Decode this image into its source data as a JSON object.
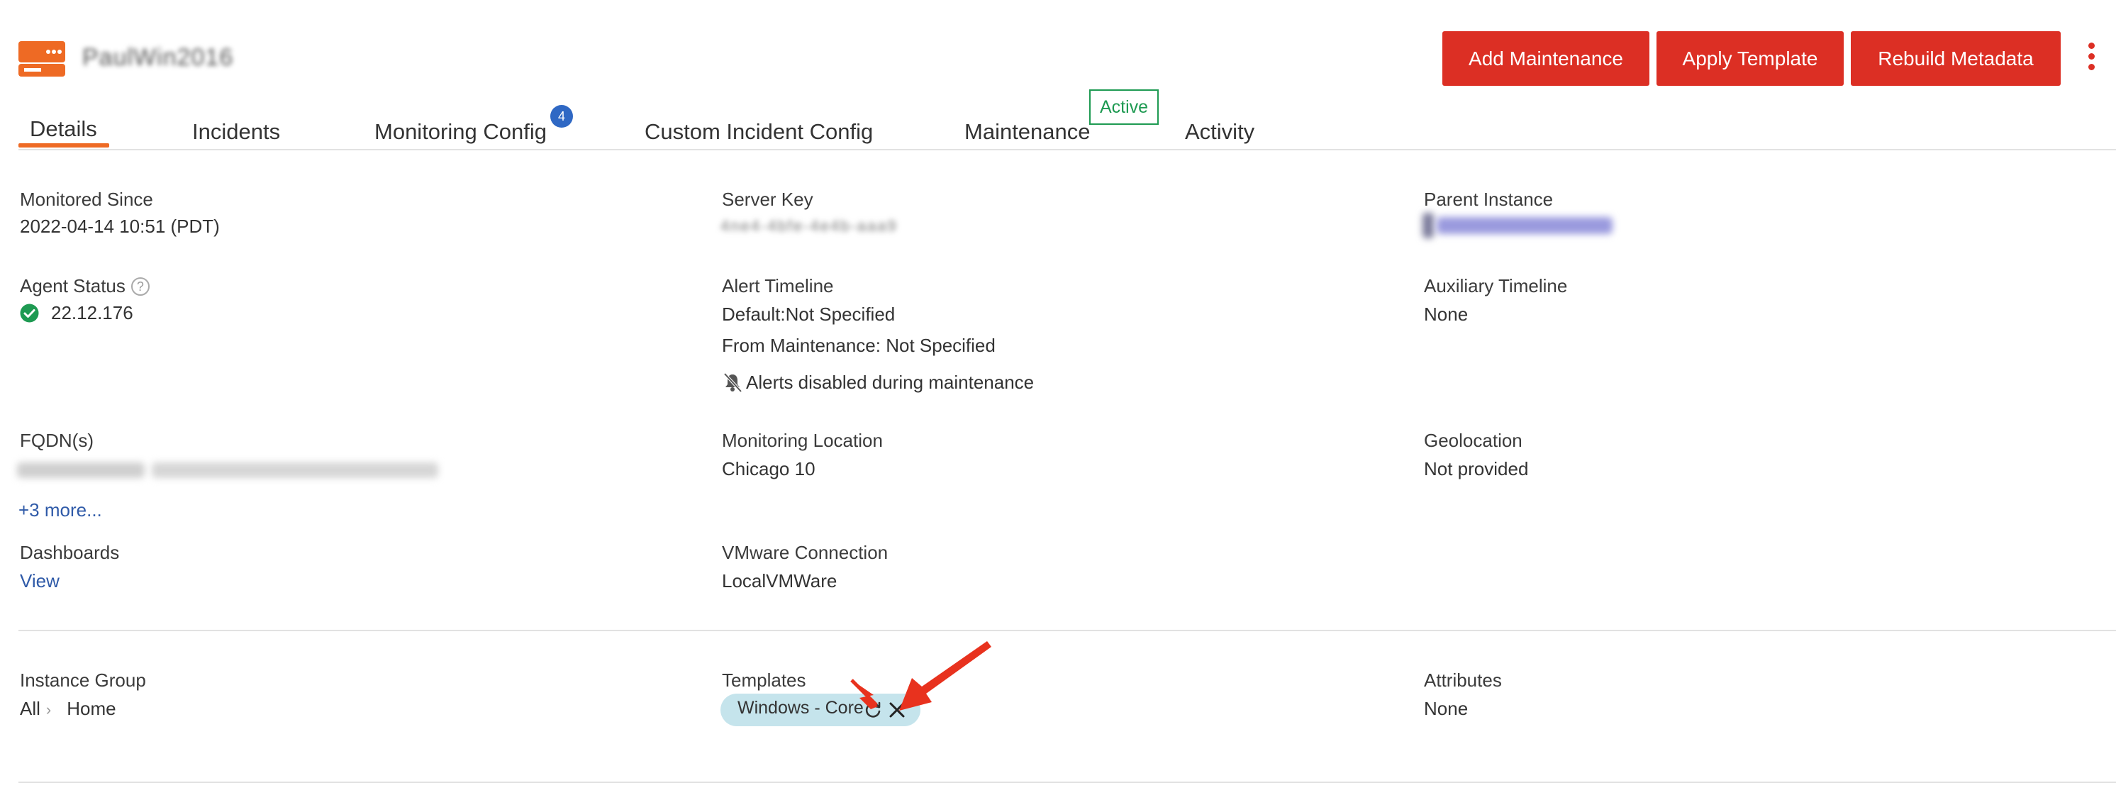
{
  "header": {
    "server_name": "PaulWin2016",
    "logo_icon": "server-icon",
    "brand_color": "#ee6a24",
    "buttons": {
      "add_maintenance": "Add Maintenance",
      "apply_template": "Apply Template",
      "rebuild_metadata": "Rebuild Metadata"
    },
    "more_icon": "vertical-dots-icon",
    "button_color": "#dc2f24"
  },
  "tabs": {
    "details": "Details",
    "incidents": "Incidents",
    "monitoring_config": "Monitoring Config",
    "monitoring_config_badge": "4",
    "custom_incident_config": "Custom Incident Config",
    "maintenance": "Maintenance",
    "maintenance_badge": "Active",
    "activity": "Activity",
    "active_tab": "Details"
  },
  "details": {
    "monitored_since": {
      "label": "Monitored Since",
      "value": "2022-04-14 10:51 (PDT)"
    },
    "server_key": {
      "label": "Server Key",
      "value": "4ne4-4bfe-4e4b-aaa9"
    },
    "parent_instance": {
      "label": "Parent Instance"
    },
    "agent_status": {
      "label": "Agent Status",
      "help_icon": "question-circle-icon",
      "status_icon": "check-circle-icon",
      "value": "22.12.176"
    },
    "alert_timeline": {
      "label": "Alert Timeline",
      "default": "Default:Not Specified",
      "from_maintenance": "From Maintenance: Not Specified",
      "alerts_note": "Alerts disabled during maintenance",
      "note_icon": "bell-slash-icon"
    },
    "auxiliary_timeline": {
      "label": "Auxiliary Timeline",
      "value": "None"
    },
    "fqdns": {
      "label": "FQDN(s)",
      "more_link": "+3 more..."
    },
    "monitoring_location": {
      "label": "Monitoring Location",
      "value": "Chicago 10"
    },
    "geolocation": {
      "label": "Geolocation",
      "value": "Not provided"
    },
    "dashboards": {
      "label": "Dashboards",
      "link": "View"
    },
    "vmware_connection": {
      "label": "VMware Connection",
      "value": "LocalVMWare"
    }
  },
  "grouping": {
    "instance_group": {
      "label": "Instance Group",
      "path": [
        "All",
        "Home"
      ]
    },
    "templates": {
      "label": "Templates",
      "chip": "Windows - Core",
      "refresh_icon": "refresh-icon",
      "remove_icon": "close-icon"
    },
    "attributes": {
      "label": "Attributes",
      "value": "None"
    }
  },
  "annotations": {
    "arrow_color": "#e8321e"
  }
}
